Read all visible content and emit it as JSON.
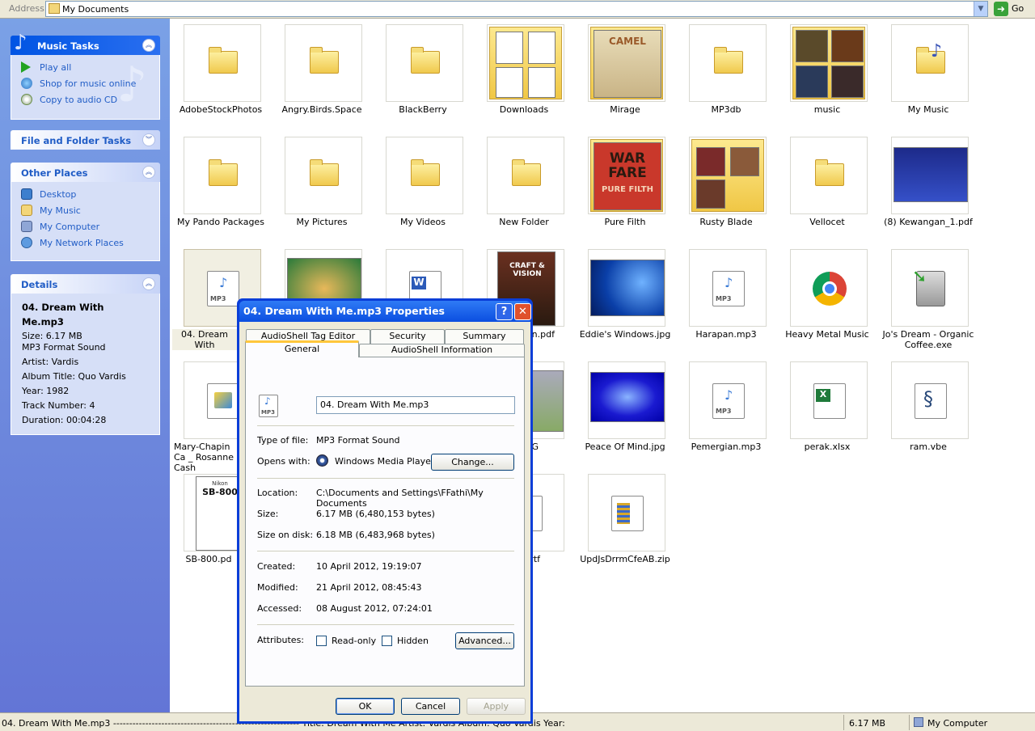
{
  "address": {
    "label": "Address",
    "value": "My Documents",
    "go": "Go"
  },
  "sidebar": {
    "music_tasks": {
      "title": "Music Tasks",
      "items": [
        "Play all",
        "Shop for music online",
        "Copy to audio CD"
      ]
    },
    "file_tasks": {
      "title": "File and Folder Tasks"
    },
    "other_places": {
      "title": "Other Places",
      "items": [
        "Desktop",
        "My Music",
        "My Computer",
        "My Network Places"
      ]
    },
    "details": {
      "title": "Details",
      "name": "04. Dream With Me.mp3",
      "lines": [
        "Size: 6.17 MB",
        "MP3 Format Sound",
        "Artist: Vardis",
        "Album Title: Quo Vardis",
        "Year: 1982",
        "Track Number: 4",
        "Duration: 00:04:28"
      ]
    }
  },
  "files": [
    "AdobeStockPhotos",
    "Angry.Birds.Space",
    "BlackBerry",
    "Downloads",
    "Mirage",
    "MP3db",
    "music",
    "My Music",
    "My Pando Packages",
    "My Pictures",
    "My Videos",
    "New Folder",
    "Pure Filth",
    "Rusty Blade",
    "Vellocet",
    "(8) Kewangan_1.pdf",
    "04. Dream With",
    "",
    "",
    "on.pdf",
    "Eddie's Windows.jpg",
    "Harapan.mp3",
    "Heavy Metal Music",
    "Jo's Dream - Organic Coffee.exe",
    "Mary-Chapin Ca _ Rosanne Cash",
    "",
    ".JPG",
    "",
    "Peace Of Mind.jpg",
    "Pemergian.mp3",
    "perak.xlsx",
    "ram.vbe",
    "SB-800.pd",
    "",
    "11.rtf",
    "",
    "UpdJsDrrmCfeAB.zip"
  ],
  "thumb_text": {
    "mirage_brand": "CAMEL",
    "warfare": "WAR FARE",
    "purefilth": "PURE FILTH",
    "craft": "CRAFT & VISION",
    "nikon": "Nikon",
    "sb800": "SB-800",
    "mp3": "MP3"
  },
  "status": {
    "text": "04. Dream With Me.mp3 ---------------------------------------------------------- Title: Dream With Me Artist: Vardis Album: Quo Vardis Year:",
    "size": "6.17 MB",
    "zone": "My Computer"
  },
  "dialog": {
    "title": "04. Dream With Me.mp3 Properties",
    "help": "?",
    "close": "✕",
    "tabs_back": [
      "AudioShell Tag Editor",
      "Security",
      "Summary"
    ],
    "tabs_front": [
      "General",
      "AudioShell Information"
    ],
    "filename": "04. Dream With Me.mp3",
    "type_label": "Type of file:",
    "type_value": "MP3 Format Sound",
    "opens_label": "Opens with:",
    "opens_value": "Windows Media Player",
    "change": "Change...",
    "location_label": "Location:",
    "location_value": "C:\\Documents and Settings\\FFathi\\My Documents",
    "size_label": "Size:",
    "size_value": "6.17 MB (6,480,153 bytes)",
    "sod_label": "Size on disk:",
    "sod_value": "6.18 MB (6,483,968 bytes)",
    "created_label": "Created:",
    "created_value": "10 April 2012, 19:19:07",
    "modified_label": "Modified:",
    "modified_value": "21 April 2012, 08:45:43",
    "accessed_label": "Accessed:",
    "accessed_value": "08 August 2012, 07:24:01",
    "attr_label": "Attributes:",
    "readonly": "Read-only",
    "hidden": "Hidden",
    "advanced": "Advanced...",
    "ok": "OK",
    "cancel": "Cancel",
    "apply": "Apply"
  }
}
